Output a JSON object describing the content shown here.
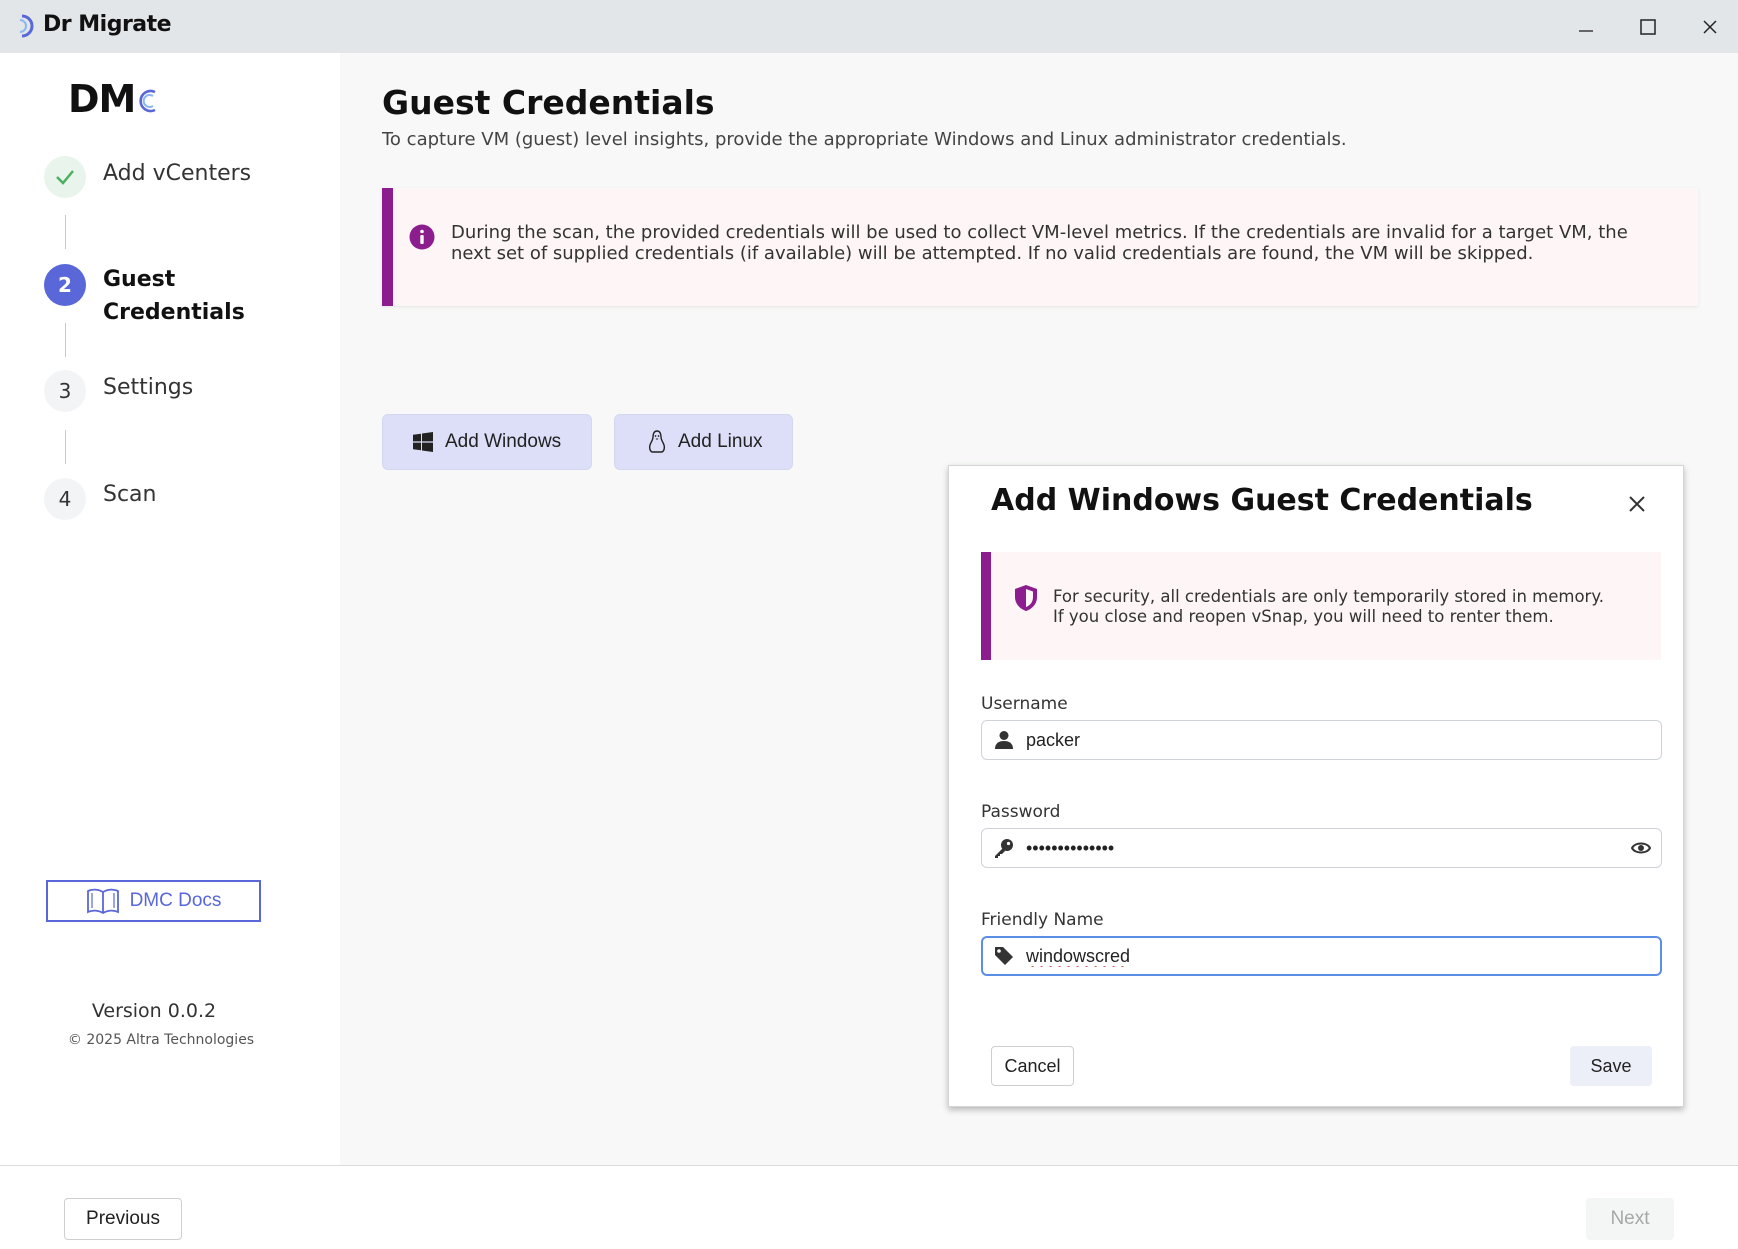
{
  "window": {
    "app_title": "Dr Migrate",
    "controls": {
      "minimize_icon": "minimize-icon",
      "maximize_icon": "maximize-icon",
      "close_icon": "close-icon"
    }
  },
  "sidebar": {
    "brand": "DM",
    "steps": [
      {
        "number": "",
        "label": "Add vCenters",
        "state": "done",
        "icon": "check-icon"
      },
      {
        "number": "2",
        "label": "Guest Credentials",
        "state": "active"
      },
      {
        "number": "3",
        "label": "Settings",
        "state": "pending"
      },
      {
        "number": "4",
        "label": "Scan",
        "state": "pending"
      }
    ],
    "docs_button": {
      "label": "DMC Docs",
      "icon": "book-icon"
    },
    "version": "Version 0.0.2",
    "copyright": "© 2025 Altra Technologies"
  },
  "main": {
    "title": "Guest Credentials",
    "subtitle": "To capture VM (guest) level insights, provide the appropriate Windows and Linux administrator credentials.",
    "alert": {
      "icon": "info-icon",
      "text": "During the scan, the provided credentials will be used to collect VM-level metrics. If the credentials are invalid for a target VM, the next set of supplied credentials (if available) will be attempted. If no valid credentials are found, the VM will be skipped."
    },
    "add_windows_label": "Add Windows",
    "add_linux_label": "Add Linux"
  },
  "dialog": {
    "title": "Add Windows Guest Credentials",
    "security_notice": {
      "icon": "shield-icon",
      "line1": "For security, all credentials are only temporarily stored in memory.",
      "line2": "If you close and reopen vSnap, you will need to renter them."
    },
    "username": {
      "label": "Username",
      "value": "packer",
      "icon": "user-icon"
    },
    "password": {
      "label": "Password",
      "value": "passwordvalue1",
      "icon": "key-icon",
      "toggle_icon": "eye-icon"
    },
    "friendly_name": {
      "label": "Friendly Name",
      "value": "windowscred",
      "icon": "tag-icon"
    },
    "cancel_label": "Cancel",
    "save_label": "Save"
  },
  "footer": {
    "previous_label": "Previous",
    "next_label": "Next"
  },
  "colors": {
    "accent": "#5967d8",
    "alert_bar": "#8b1d8e",
    "alert_bg": "#fdf5f6",
    "success": "#4caf60",
    "focus_border": "#5b8ee6"
  }
}
